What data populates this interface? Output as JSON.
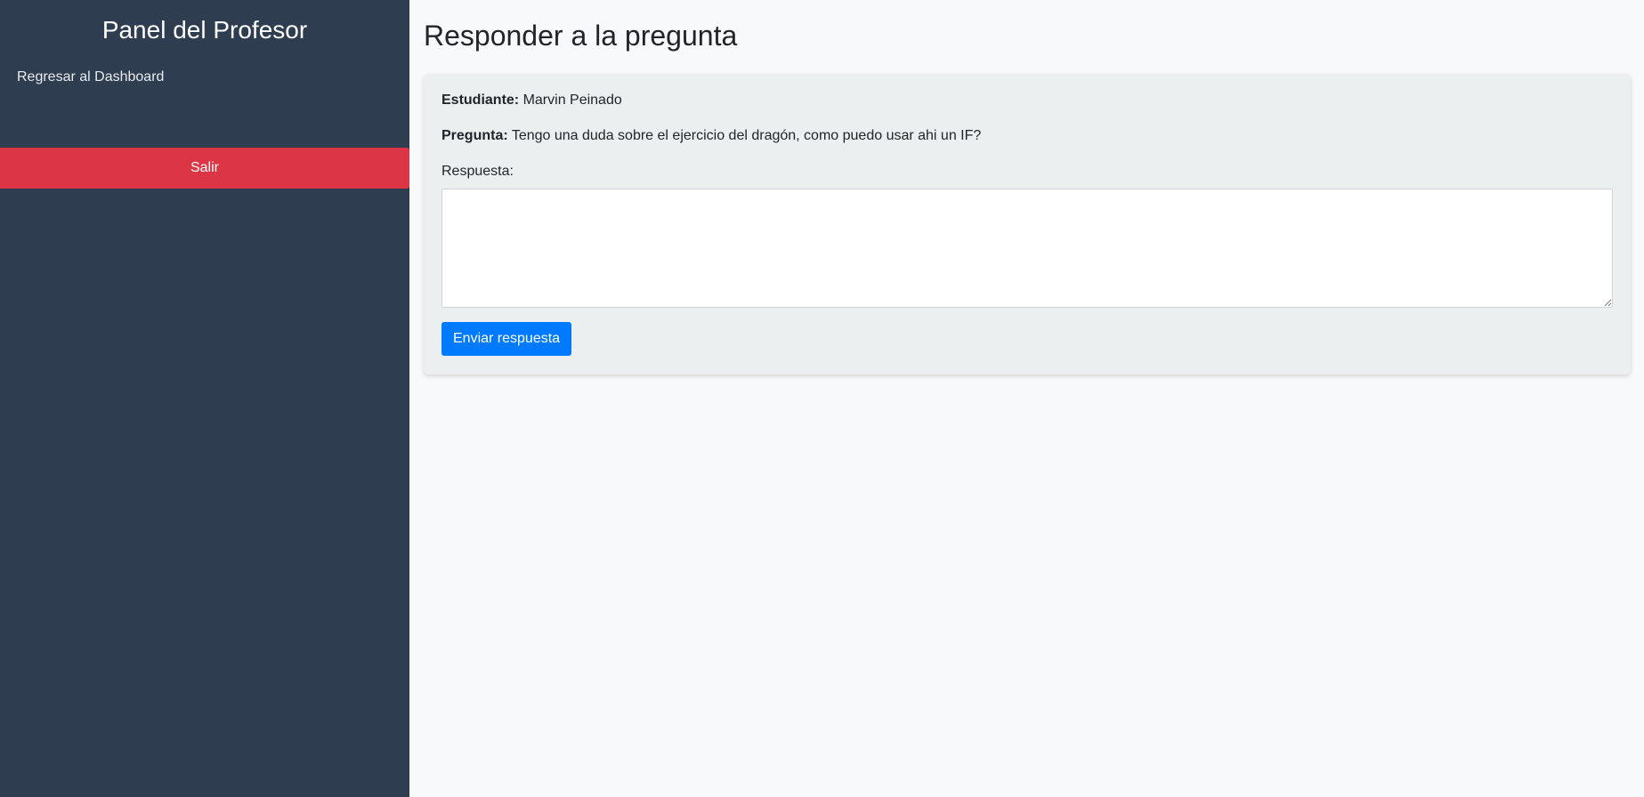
{
  "sidebar": {
    "title": "Panel del Profesor",
    "back_link": "Regresar al Dashboard",
    "logout_label": "Salir"
  },
  "main": {
    "title": "Responder a la pregunta",
    "student_label": "Estudiante:",
    "student_name": "Marvin Peinado",
    "question_label": "Pregunta:",
    "question_text": "Tengo una duda sobre el ejercicio del dragón, como puedo usar ahi un IF?",
    "answer_label": "Respuesta:",
    "answer_value": "",
    "submit_label": "Enviar respuesta"
  },
  "colors": {
    "sidebar_bg": "#2e3d50",
    "logout_bg": "#dc3545",
    "primary": "#007bff",
    "card_bg": "#eceff0",
    "page_bg": "#f8f9fa"
  }
}
